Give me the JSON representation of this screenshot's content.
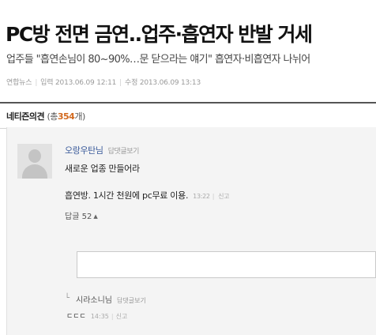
{
  "article": {
    "headline": "PC방 전면 금연..업주·흡연자 반발 거세",
    "subhead": "업주들 \"흡연손님이 80~90%…문 닫으라는 얘기\" 흡연자·비흡연자 나뉘어",
    "source": "연합뉴스",
    "published_label": "입력",
    "published": "2013.06.09 12:11",
    "modified_label": "수정",
    "modified": "2013.06.09 13:13"
  },
  "comments": {
    "title": "네티즌의견",
    "count_prefix": "(총",
    "count": "354",
    "count_suffix": "개)",
    "items": [
      {
        "author": "오랑우탄님",
        "reply_link": "답댓글보기",
        "line1": "새로운 업종 만들어라",
        "line2": "흡연방. 1시간 천원에 pc무료 이용.",
        "time": "13:22",
        "report": "신고",
        "reply_label": "답글",
        "reply_count": "52",
        "reply_arrow": "▲"
      }
    ],
    "reply": {
      "arrow": "└",
      "author": "시라소니님",
      "reply_link": "답댓글보기",
      "body": "ㄷㄷㄷ",
      "time": "14:35",
      "report": "신고"
    }
  }
}
